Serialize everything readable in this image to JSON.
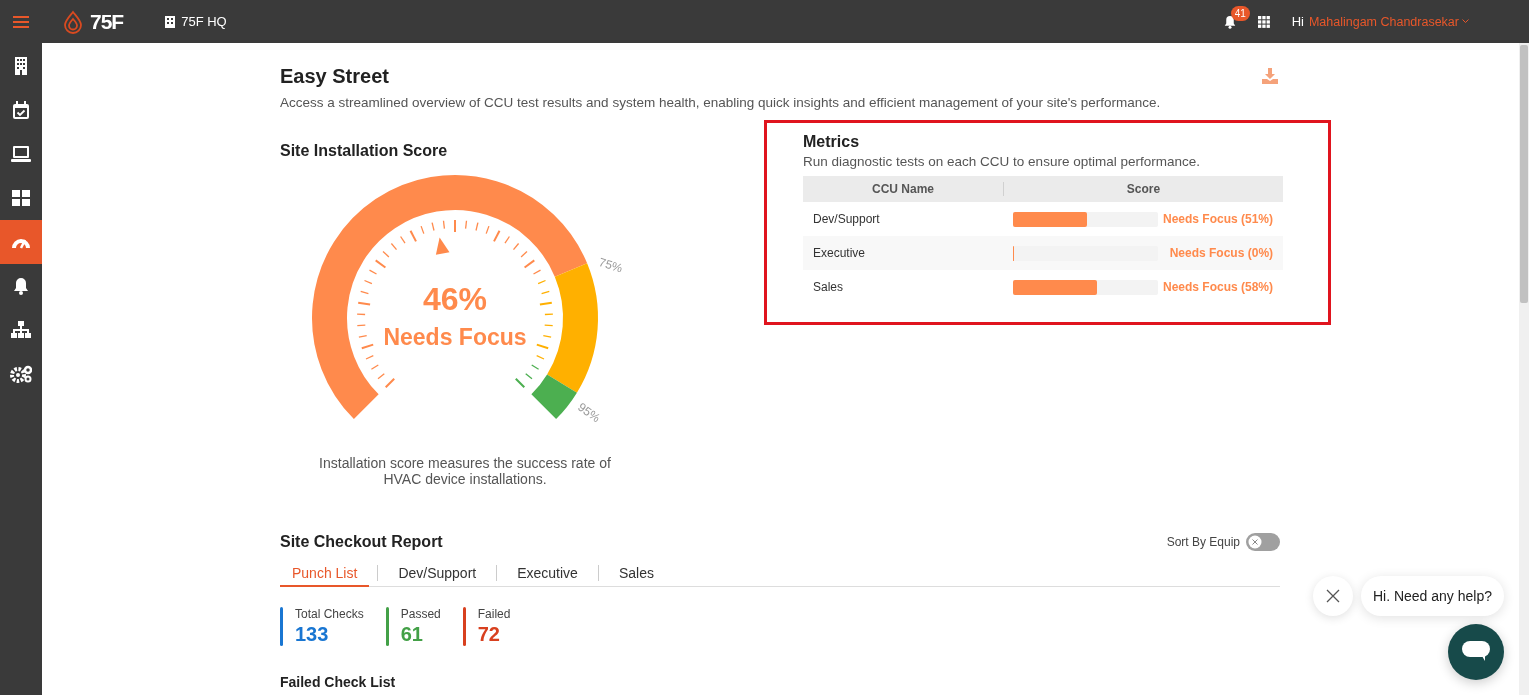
{
  "header": {
    "brand": "75F",
    "site": "75F HQ",
    "notification_count": "41",
    "greeting": "Hi",
    "user_name": "Mahalingam Chandrasekar"
  },
  "sidebar": {
    "items": [
      {
        "kind": "building",
        "selected": false
      },
      {
        "kind": "calendar",
        "selected": false
      },
      {
        "kind": "laptop",
        "selected": false
      },
      {
        "kind": "grid",
        "selected": false
      },
      {
        "kind": "gauge",
        "selected": true
      },
      {
        "kind": "bell",
        "selected": false
      },
      {
        "kind": "hierarchy",
        "selected": false
      },
      {
        "kind": "gears",
        "selected": false
      }
    ]
  },
  "page": {
    "title": "Easy Street",
    "description": "Access a streamlined overview of CCU test results and system health, enabling quick insights and efficient management of your site's performance."
  },
  "installation_score": {
    "title": "Site Installation Score",
    "level": 0.46,
    "value": "46%",
    "status": "Needs Focus",
    "scale_labels": [
      "75%",
      "95%"
    ],
    "caption": "Installation score measures the success rate of HVAC device installations."
  },
  "metrics": {
    "highlighted": true,
    "title": "Metrics",
    "description": "Run diagnostic tests on each CCU to ensure optimal performance.",
    "columns": [
      "CCU Name",
      "Score"
    ],
    "rows": [
      {
        "name": "Dev/Support",
        "level": 0.51,
        "status": "Needs Focus (51%)"
      },
      {
        "name": "Executive",
        "level": 0,
        "status": "Needs Focus (0%)"
      },
      {
        "name": "Sales",
        "level": 0.58,
        "status": "Needs Focus (58%)"
      }
    ]
  },
  "checkout_report": {
    "title": "Site Checkout Report",
    "sort_toggle": {
      "label": "Sort By Equip",
      "on": false
    },
    "tabs": [
      {
        "label": "Punch List",
        "selected": true
      },
      {
        "label": "Dev/Support",
        "selected": false
      },
      {
        "label": "Executive",
        "selected": false
      },
      {
        "label": "Sales",
        "selected": false
      }
    ],
    "stats": [
      {
        "label": "Total Checks",
        "value": "133",
        "color": "#1976d2"
      },
      {
        "label": "Passed",
        "value": "61",
        "color": "#43a047"
      },
      {
        "label": "Failed",
        "value": "72",
        "color": "#d8401f"
      }
    ],
    "failed_list_title": "Failed Check List"
  },
  "chat": {
    "message": "Hi. Need any help?"
  }
}
